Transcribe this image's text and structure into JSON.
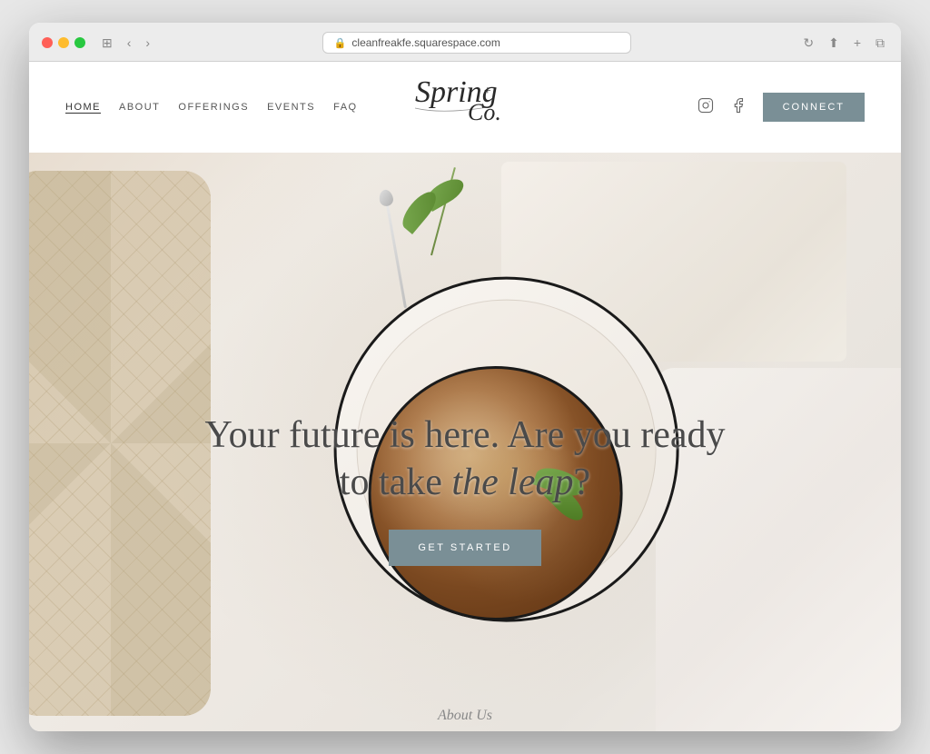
{
  "browser": {
    "url": "cleanfreakfe.squarespace.com",
    "reload_label": "↻"
  },
  "header": {
    "nav": {
      "home": "HOME",
      "about": "ABOUT",
      "offerings": "OFFERINGS",
      "events": "EVENTS",
      "faq": "FAQ"
    },
    "logo_text": "Spring+Co",
    "connect_label": "CONNeCT",
    "instagram_icon": "instagram",
    "facebook_icon": "facebook"
  },
  "hero": {
    "headline_1": "Your future is here. Are you ready",
    "headline_2": "to take ",
    "headline_italic": "the leap",
    "headline_end": "?",
    "cta_label": "GET STARTED"
  },
  "footer_peek": {
    "label": "About Us"
  }
}
